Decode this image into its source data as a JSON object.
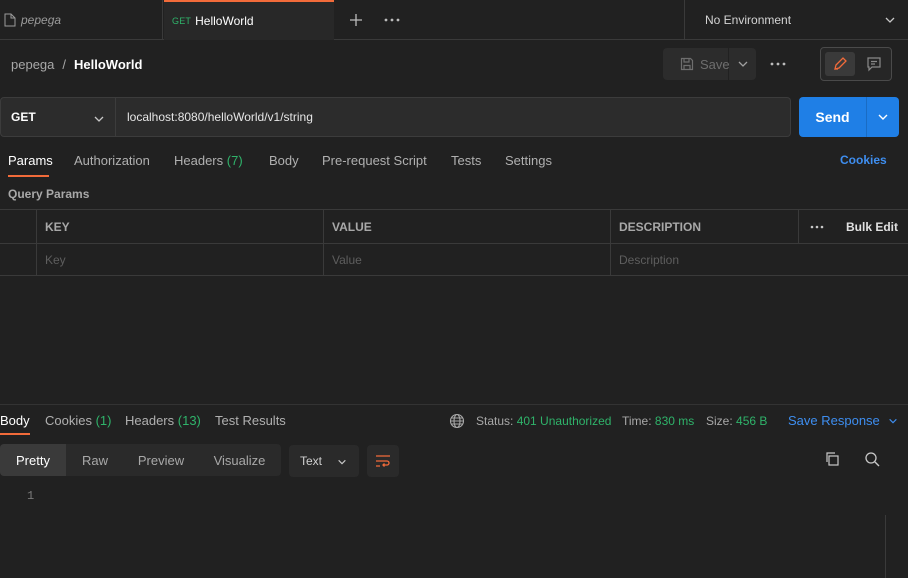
{
  "tabs": [
    {
      "label": "pepega",
      "method": ""
    },
    {
      "label": "HelloWorld",
      "method": "GET"
    }
  ],
  "environment": {
    "selected": "No Environment"
  },
  "header": {
    "workspace": "pepega",
    "separator": "/",
    "request_name": "HelloWorld",
    "save_label": "Save"
  },
  "request": {
    "method": "GET",
    "url": "localhost:8080/helloWorld/v1/string",
    "send_label": "Send"
  },
  "request_tabs": [
    {
      "label": "Params",
      "count": ""
    },
    {
      "label": "Authorization",
      "count": ""
    },
    {
      "label": "Headers",
      "count": "(7)"
    },
    {
      "label": "Body",
      "count": ""
    },
    {
      "label": "Pre-request Script",
      "count": ""
    },
    {
      "label": "Tests",
      "count": ""
    },
    {
      "label": "Settings",
      "count": ""
    }
  ],
  "cookies_link": "Cookies",
  "query_params": {
    "title": "Query Params",
    "columns": [
      "KEY",
      "VALUE",
      "DESCRIPTION"
    ],
    "bulk_edit": "Bulk Edit",
    "placeholders": [
      "Key",
      "Value",
      "Description"
    ]
  },
  "response": {
    "tabs": [
      {
        "label": "Body",
        "count": ""
      },
      {
        "label": "Cookies",
        "count": "(1)"
      },
      {
        "label": "Headers",
        "count": "(13)"
      },
      {
        "label": "Test Results",
        "count": ""
      }
    ],
    "status_label": "Status:",
    "status_value": "401 Unauthorized",
    "time_label": "Time:",
    "time_value": "830 ms",
    "size_label": "Size:",
    "size_value": "456 B",
    "save_response": "Save Response",
    "view_modes": [
      "Pretty",
      "Raw",
      "Preview",
      "Visualize"
    ],
    "format": "Text",
    "line_numbers": [
      "1"
    ]
  },
  "colors": {
    "accent": "#f26b3a",
    "send": "#1f7fe6",
    "link": "#3e8ef0",
    "success": "#2fb36a",
    "background": "#212121"
  }
}
